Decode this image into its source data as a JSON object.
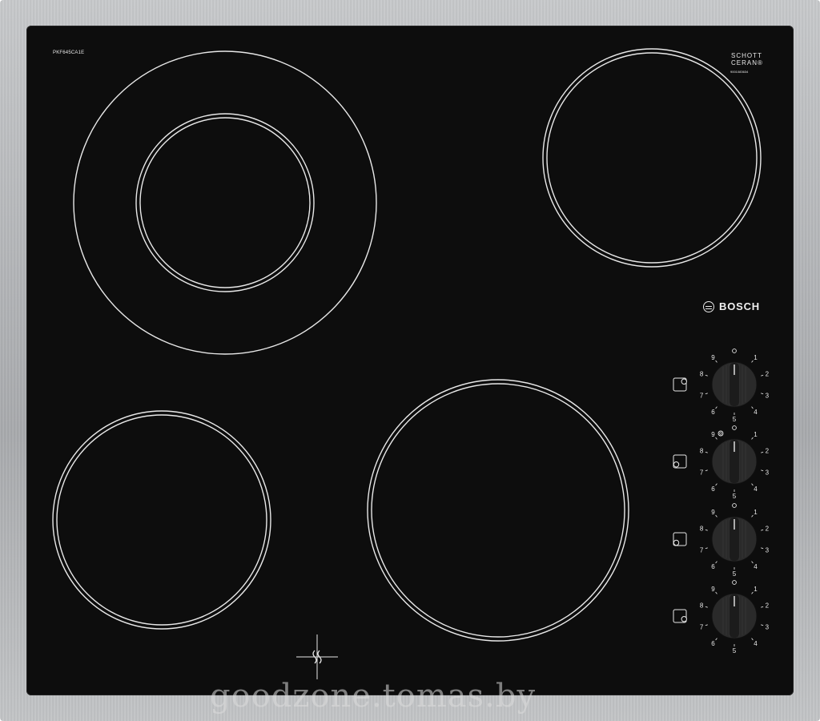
{
  "model_label": "PKF645CA1E",
  "glass_brand": {
    "line1": "SCHOTT",
    "line2": "CERAN®"
  },
  "serial_label": "9001083634",
  "brand": {
    "name": "BOSCH"
  },
  "knob_scale": [
    "0",
    "1",
    "2",
    "3",
    "4",
    "5",
    "6",
    "7",
    "8",
    "9"
  ],
  "watermark": "goodzone.tomas.by",
  "colors": {
    "glass": "#0d0d0d",
    "frame": "#b8babd",
    "lines": "#e8e8e8"
  }
}
